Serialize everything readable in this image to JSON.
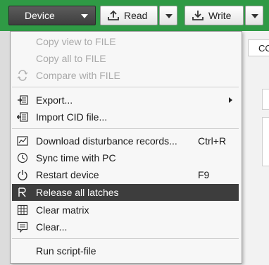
{
  "toolbar": {
    "device_label": "Device",
    "read_label": "Read",
    "write_label": "Write"
  },
  "background": {
    "tab_label": "CO"
  },
  "menu": {
    "items": [
      {
        "label": "Copy view to FILE",
        "shortcut": "",
        "disabled": true,
        "icon": "none"
      },
      {
        "label": "Copy all to FILE",
        "shortcut": "",
        "disabled": true,
        "icon": "none"
      },
      {
        "label": "Compare with FILE",
        "shortcut": "",
        "disabled": true,
        "icon": "compare-icon"
      },
      {
        "label": "Export...",
        "shortcut": "",
        "disabled": false,
        "icon": "export-icon",
        "submenu": true
      },
      {
        "label": "Import CID file...",
        "shortcut": "",
        "disabled": false,
        "icon": "import-icon"
      },
      {
        "label": "Download disturbance records...",
        "shortcut": "Ctrl+R",
        "disabled": false,
        "icon": "chart-icon"
      },
      {
        "label": "Sync time with PC",
        "shortcut": "",
        "disabled": false,
        "icon": "clock-icon"
      },
      {
        "label": "Restart device",
        "shortcut": "F9",
        "disabled": false,
        "icon": "power-icon"
      },
      {
        "label": "Release all latches",
        "shortcut": "",
        "disabled": false,
        "icon": "latch-icon",
        "highlighted": true
      },
      {
        "label": "Clear matrix",
        "shortcut": "",
        "disabled": false,
        "icon": "grid-icon"
      },
      {
        "label": "Clear...",
        "shortcut": "",
        "disabled": false,
        "icon": "clear-icon"
      },
      {
        "label": "Run script-file",
        "shortcut": "",
        "disabled": false,
        "icon": "none"
      }
    ]
  },
  "colors": {
    "toolbar_bg": "#2f9a45",
    "device_button_bg": "#4a4a4a",
    "highlight_bg": "#3d3d3d",
    "disabled_text": "#a9a9a9"
  }
}
